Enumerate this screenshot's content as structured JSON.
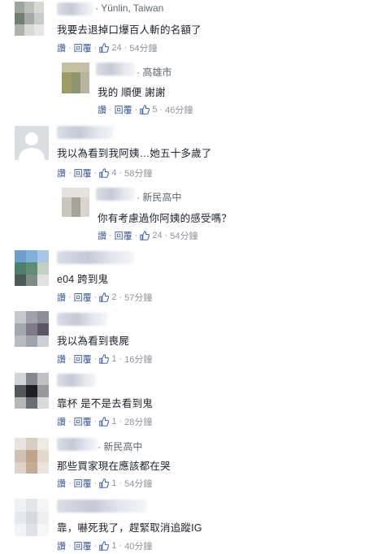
{
  "actions": {
    "reply_short": "讚",
    "reply": "回覆",
    "sep": "·"
  },
  "comments": [
    {
      "location": "Yünlin, Taiwan",
      "text": "我要去退掉口爆百人斬的名額了",
      "likes": "24",
      "time": "54分鐘"
    },
    {
      "location": "高雄市",
      "text": "我的 順便 謝謝",
      "likes": "5",
      "time": "46分鐘"
    },
    {
      "location": "",
      "text": "我以為看到我阿姨…她五十多歲了",
      "likes": "4",
      "time": "58分鐘"
    },
    {
      "location": "新民高中",
      "text": "你有考慮過你阿姨的感受嗎？",
      "likes": "24",
      "time": "54分鐘"
    },
    {
      "location": "",
      "text": "e04 跨到鬼",
      "likes": "2",
      "time": "57分鐘"
    },
    {
      "location": "",
      "text": "我以為看到喪屍",
      "likes": "1",
      "time": "16分鐘"
    },
    {
      "location": "",
      "text": "靠杯 是不是去看到鬼",
      "likes": "1",
      "time": "28分鐘"
    },
    {
      "location": "新民高中",
      "text": "那些買家現在應該都在哭",
      "likes": "1",
      "time": "54分鐘"
    },
    {
      "location": "",
      "text": "靠，嚇死我了，趕緊取消追蹤IG",
      "likes": "1",
      "time": "40分鐘"
    }
  ],
  "colors": {
    "link": "#385898",
    "meta": "#90949c",
    "text": "#1d2129"
  }
}
